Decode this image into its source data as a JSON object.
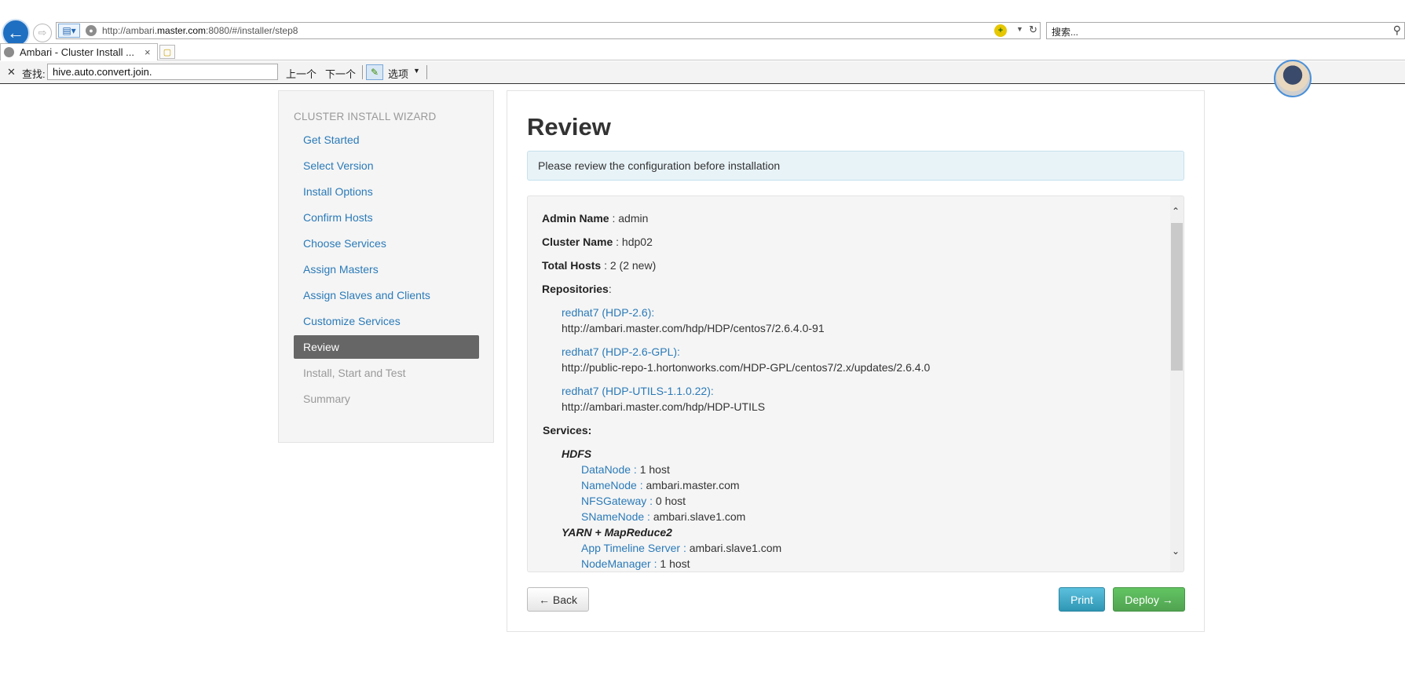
{
  "browser": {
    "url_prefix": "http://ambari.",
    "url_host": "master.com",
    "url_suffix": ":8080/#/installer/step8",
    "search_placeholder": "搜索...",
    "tab_title": "Ambari - Cluster Install ...",
    "tab_close": "×"
  },
  "find_bar": {
    "label": "查找:",
    "value": "hive.auto.convert.join.",
    "prev": "上一个",
    "next": "下一个",
    "options": "选项"
  },
  "sidebar": {
    "title": "CLUSTER INSTALL WIZARD",
    "items": [
      {
        "label": "Get Started",
        "state": "link"
      },
      {
        "label": "Select Version",
        "state": "link"
      },
      {
        "label": "Install Options",
        "state": "link"
      },
      {
        "label": "Confirm Hosts",
        "state": "link"
      },
      {
        "label": "Choose Services",
        "state": "link"
      },
      {
        "label": "Assign Masters",
        "state": "link"
      },
      {
        "label": "Assign Slaves and Clients",
        "state": "link"
      },
      {
        "label": "Customize Services",
        "state": "link"
      },
      {
        "label": "Review",
        "state": "active"
      },
      {
        "label": "Install, Start and Test",
        "state": "disabled"
      },
      {
        "label": "Summary",
        "state": "disabled"
      }
    ]
  },
  "main": {
    "title": "Review",
    "alert": "Please review the configuration before installation",
    "admin_label": "Admin Name",
    "admin_value": " : admin",
    "cluster_label": "Cluster Name",
    "cluster_value": " : hdp02",
    "hosts_label": "Total Hosts",
    "hosts_value": " : 2 (2 new)",
    "repos_label": "Repositories",
    "repos_colon": ":",
    "repos": [
      {
        "name": "redhat7 (HDP-2.6):",
        "url": "http://ambari.master.com/hdp/HDP/centos7/2.6.4.0-91"
      },
      {
        "name": "redhat7 (HDP-2.6-GPL):",
        "url": "http://public-repo-1.hortonworks.com/HDP-GPL/centos7/2.x/updates/2.6.4.0"
      },
      {
        "name": "redhat7 (HDP-UTILS-1.1.0.22):",
        "url": "http://ambari.master.com/hdp/HDP-UTILS"
      }
    ],
    "services_label": "Services:",
    "hdfs": {
      "name": "HDFS",
      "components": [
        {
          "name": "DataNode :",
          "value": " 1 host"
        },
        {
          "name": "NameNode :",
          "value": " ambari.master.com"
        },
        {
          "name": "NFSGateway :",
          "value": " 0 host"
        },
        {
          "name": "SNameNode :",
          "value": " ambari.slave1.com"
        }
      ]
    },
    "yarn": {
      "name": "YARN + MapReduce2",
      "components": [
        {
          "name": "App Timeline Server :",
          "value": " ambari.slave1.com"
        },
        {
          "name": "NodeManager :",
          "value": " 1 host"
        }
      ]
    },
    "buttons": {
      "back": "← Back",
      "print": "Print",
      "deploy": "Deploy →"
    }
  }
}
